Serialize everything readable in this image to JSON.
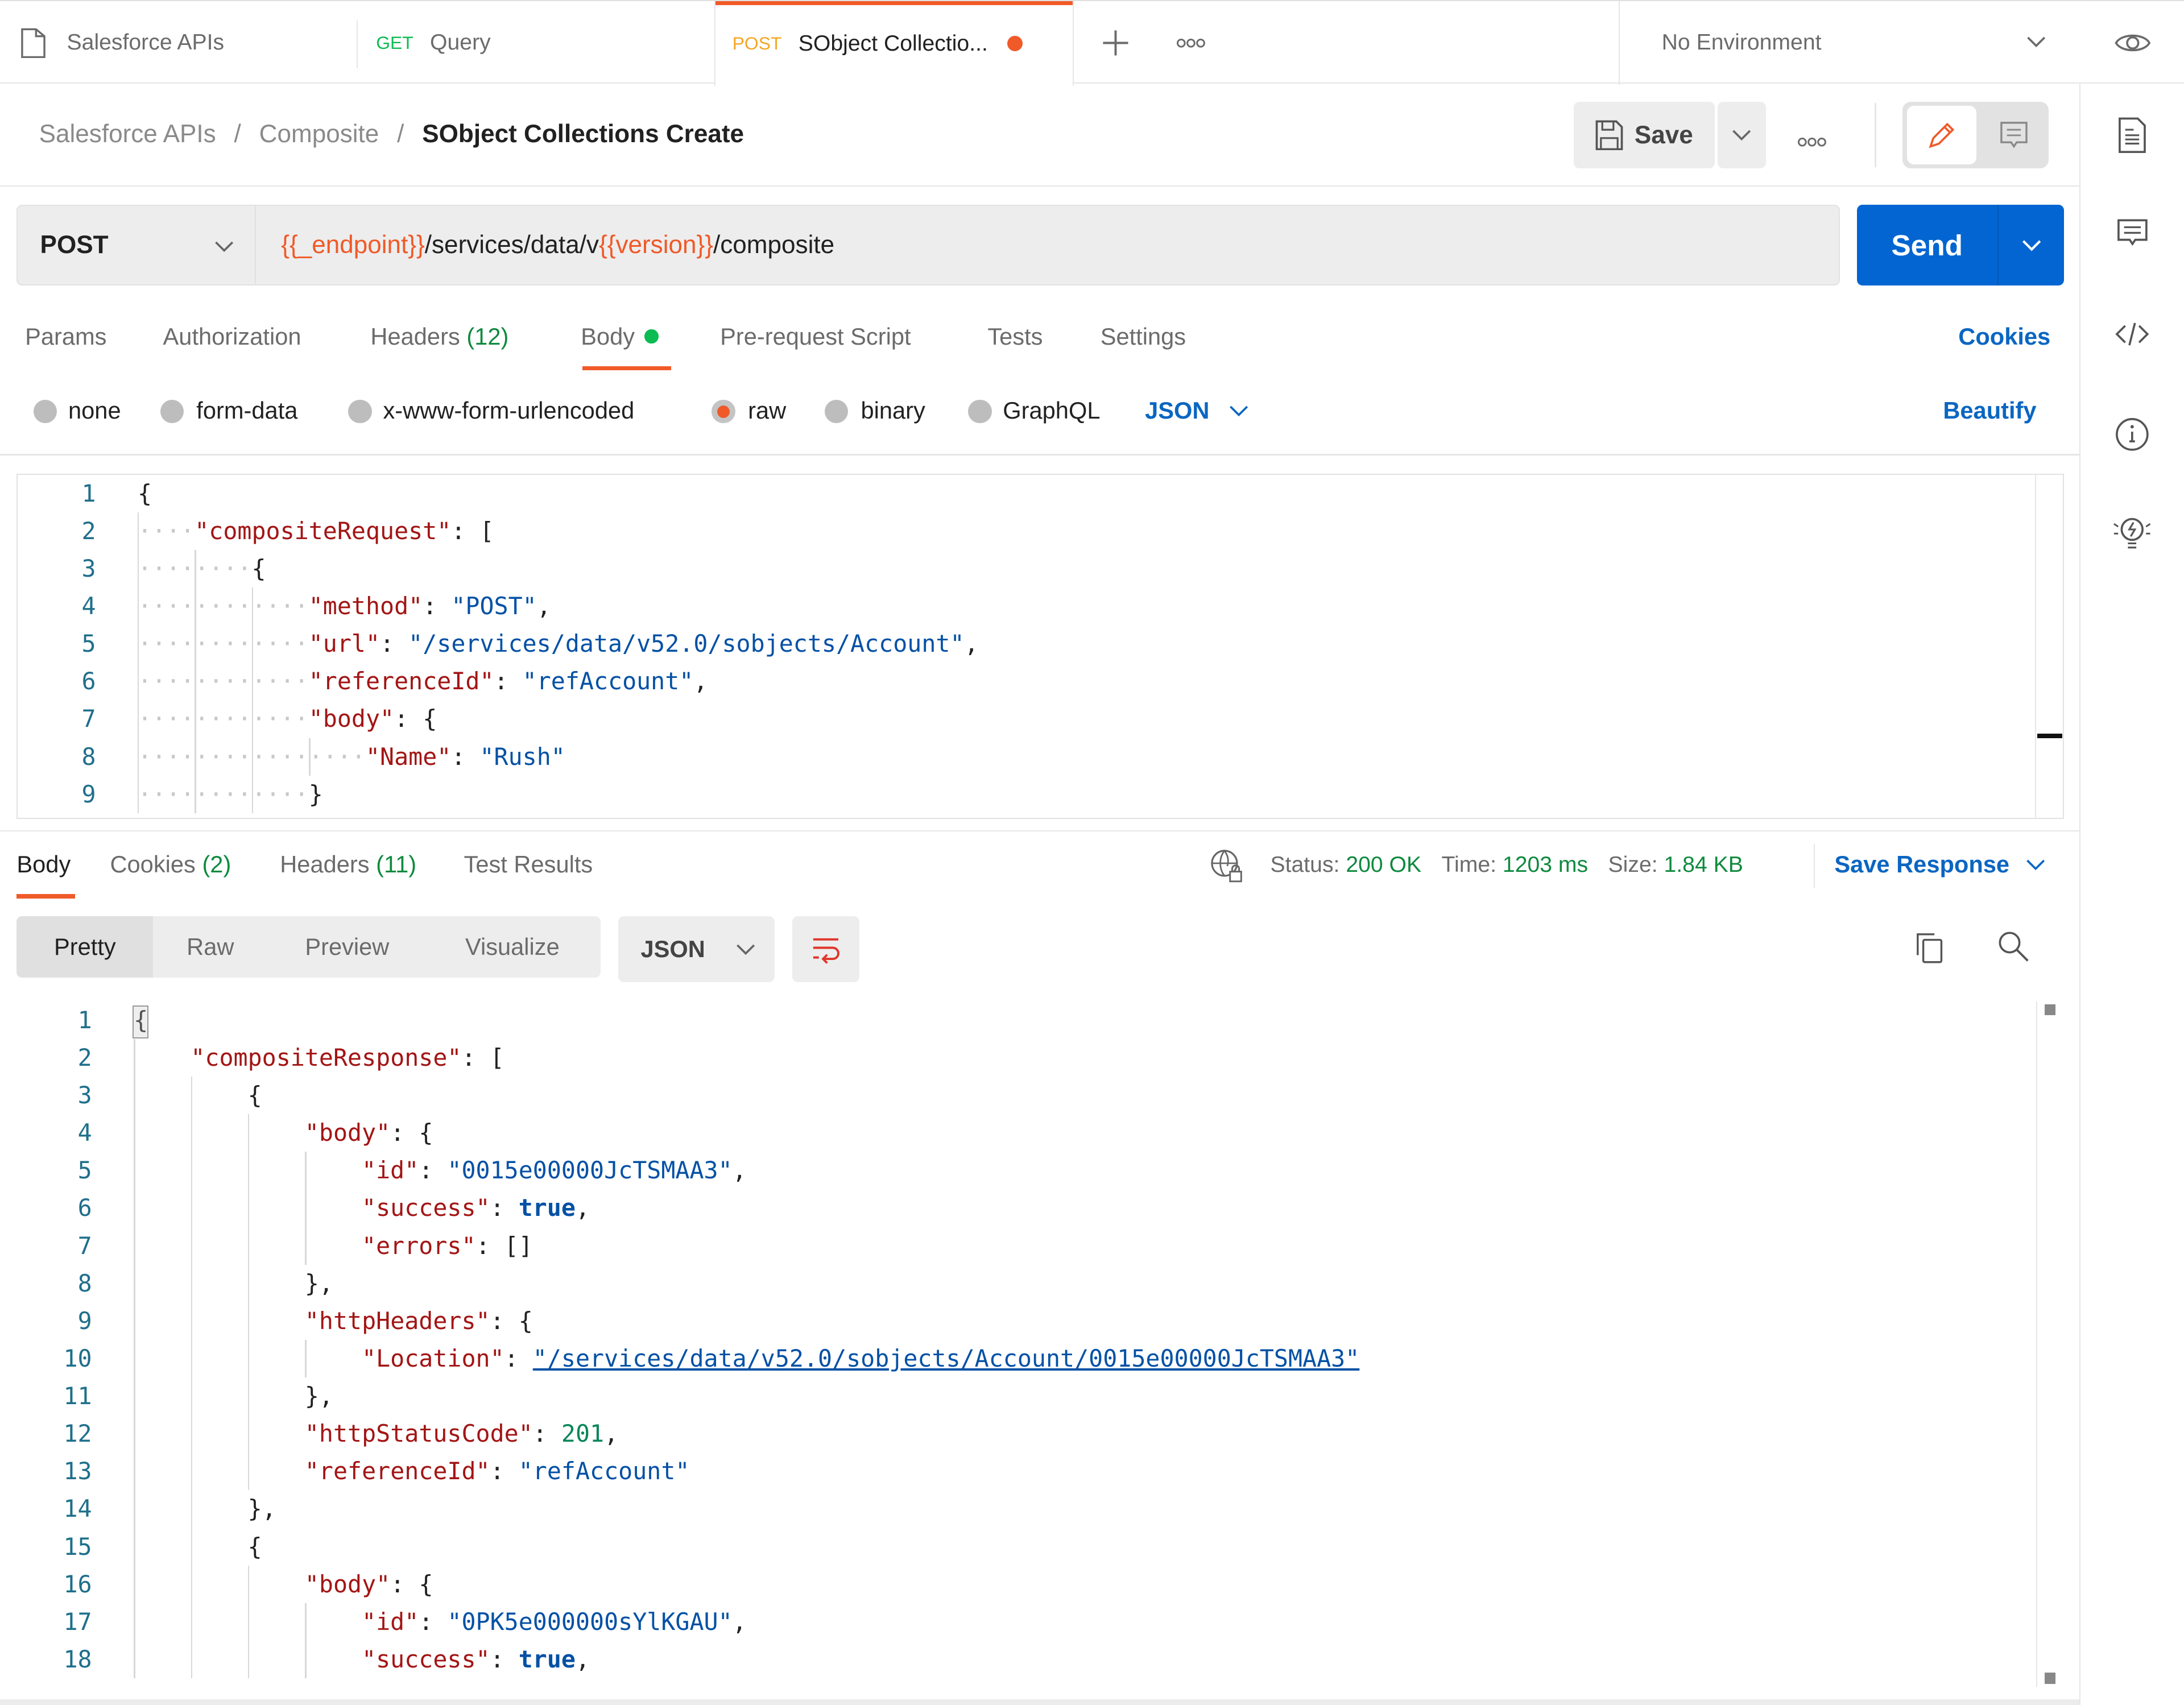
{
  "tabs": [
    {
      "icon": "collection-icon",
      "label": "Salesforce APIs"
    },
    {
      "method": "GET",
      "method_color": "#0cbb52",
      "label": "Query"
    },
    {
      "method": "POST",
      "method_color": "#f5a623",
      "label": "SObject Collectio...",
      "unsaved": true,
      "active": true
    }
  ],
  "tabbar": {
    "environment": "No Environment"
  },
  "breadcrumb": {
    "parts": [
      "Salesforce APIs",
      "Composite"
    ],
    "current": "SObject Collections Create",
    "separator": "/"
  },
  "toolbar": {
    "save_label": "Save"
  },
  "request": {
    "method": "POST",
    "url_parts": [
      {
        "text": "{{_endpoint}}",
        "var": true
      },
      {
        "text": "/services/data/v",
        "var": false
      },
      {
        "text": "{{version}}",
        "var": true
      },
      {
        "text": "/composite",
        "var": false
      }
    ],
    "send_label": "Send"
  },
  "request_tabs": {
    "params": "Params",
    "authorization": "Authorization",
    "headers": "Headers",
    "headers_count": "(12)",
    "body": "Body",
    "prerequest": "Pre-request Script",
    "tests": "Tests",
    "settings": "Settings",
    "cookies": "Cookies"
  },
  "body_modes": {
    "none": "none",
    "form_data": "form-data",
    "urlencoded": "x-www-form-urlencoded",
    "raw": "raw",
    "binary": "binary",
    "graphql": "GraphQL",
    "selected": "raw",
    "format": "JSON",
    "beautify": "Beautify"
  },
  "request_body": [
    {
      "n": "1",
      "indent": 0,
      "tokens": [
        [
          "p",
          "{"
        ]
      ]
    },
    {
      "n": "2",
      "indent": 1,
      "tokens": [
        [
          "k",
          "\"compositeRequest\""
        ],
        [
          "p",
          ": ["
        ]
      ]
    },
    {
      "n": "3",
      "indent": 2,
      "tokens": [
        [
          "p",
          "{"
        ]
      ]
    },
    {
      "n": "4",
      "indent": 3,
      "tokens": [
        [
          "k",
          "\"method\""
        ],
        [
          "p",
          ": "
        ],
        [
          "s",
          "\"POST\""
        ],
        [
          "p",
          ","
        ]
      ]
    },
    {
      "n": "5",
      "indent": 3,
      "tokens": [
        [
          "k",
          "\"url\""
        ],
        [
          "p",
          ": "
        ],
        [
          "s",
          "\"/services/data/v52.0/sobjects/Account\""
        ],
        [
          "p",
          ","
        ]
      ]
    },
    {
      "n": "6",
      "indent": 3,
      "tokens": [
        [
          "k",
          "\"referenceId\""
        ],
        [
          "p",
          ": "
        ],
        [
          "s",
          "\"refAccount\""
        ],
        [
          "p",
          ","
        ]
      ]
    },
    {
      "n": "7",
      "indent": 3,
      "tokens": [
        [
          "k",
          "\"body\""
        ],
        [
          "p",
          ": {"
        ]
      ]
    },
    {
      "n": "8",
      "indent": 4,
      "tokens": [
        [
          "k",
          "\"Name\""
        ],
        [
          "p",
          ": "
        ],
        [
          "s",
          "\"Rush\""
        ]
      ]
    },
    {
      "n": "9",
      "indent": 3,
      "tokens": [
        [
          "p",
          "}"
        ]
      ]
    }
  ],
  "response_tabs": {
    "body": "Body",
    "cookies": "Cookies",
    "cookies_count": "(2)",
    "headers": "Headers",
    "headers_count": "(11)",
    "test_results": "Test Results"
  },
  "response_meta": {
    "status_label": "Status:",
    "status": "200 OK",
    "time_label": "Time:",
    "time": "1203 ms",
    "size_label": "Size:",
    "size": "1.84 KB",
    "save_response": "Save Response"
  },
  "response_view": {
    "pretty": "Pretty",
    "raw": "Raw",
    "preview": "Preview",
    "visualize": "Visualize",
    "format": "JSON"
  },
  "response_body": [
    {
      "n": "1",
      "indent": 0,
      "tokens": [
        [
          "p",
          "{"
        ]
      ]
    },
    {
      "n": "2",
      "indent": 1,
      "tokens": [
        [
          "k",
          "\"compositeResponse\""
        ],
        [
          "p",
          ": ["
        ]
      ]
    },
    {
      "n": "3",
      "indent": 2,
      "tokens": [
        [
          "p",
          "{"
        ]
      ]
    },
    {
      "n": "4",
      "indent": 3,
      "tokens": [
        [
          "k",
          "\"body\""
        ],
        [
          "p",
          ": {"
        ]
      ]
    },
    {
      "n": "5",
      "indent": 4,
      "tokens": [
        [
          "k",
          "\"id\""
        ],
        [
          "p",
          ": "
        ],
        [
          "s",
          "\"0015e00000JcTSMAA3\""
        ],
        [
          "p",
          ","
        ]
      ]
    },
    {
      "n": "6",
      "indent": 4,
      "tokens": [
        [
          "k",
          "\"success\""
        ],
        [
          "p",
          ": "
        ],
        [
          "b",
          "true"
        ],
        [
          "p",
          ","
        ]
      ]
    },
    {
      "n": "7",
      "indent": 4,
      "tokens": [
        [
          "k",
          "\"errors\""
        ],
        [
          "p",
          ": []"
        ]
      ]
    },
    {
      "n": "8",
      "indent": 3,
      "tokens": [
        [
          "p",
          "},"
        ]
      ]
    },
    {
      "n": "9",
      "indent": 3,
      "tokens": [
        [
          "k",
          "\"httpHeaders\""
        ],
        [
          "p",
          ": {"
        ]
      ]
    },
    {
      "n": "10",
      "indent": 4,
      "tokens": [
        [
          "k",
          "\"Location\""
        ],
        [
          "p",
          ": "
        ],
        [
          "u",
          "\"/services/data/v52.0/sobjects/Account/0015e00000JcTSMAA3\""
        ]
      ]
    },
    {
      "n": "11",
      "indent": 3,
      "tokens": [
        [
          "p",
          "},"
        ]
      ]
    },
    {
      "n": "12",
      "indent": 3,
      "tokens": [
        [
          "k",
          "\"httpStatusCode\""
        ],
        [
          "p",
          ": "
        ],
        [
          "n",
          "201"
        ],
        [
          "p",
          ","
        ]
      ]
    },
    {
      "n": "13",
      "indent": 3,
      "tokens": [
        [
          "k",
          "\"referenceId\""
        ],
        [
          "p",
          ": "
        ],
        [
          "s",
          "\"refAccount\""
        ]
      ]
    },
    {
      "n": "14",
      "indent": 2,
      "tokens": [
        [
          "p",
          "},"
        ]
      ]
    },
    {
      "n": "15",
      "indent": 2,
      "tokens": [
        [
          "p",
          "{"
        ]
      ]
    },
    {
      "n": "16",
      "indent": 3,
      "tokens": [
        [
          "k",
          "\"body\""
        ],
        [
          "p",
          ": {"
        ]
      ]
    },
    {
      "n": "17",
      "indent": 4,
      "tokens": [
        [
          "k",
          "\"id\""
        ],
        [
          "p",
          ": "
        ],
        [
          "s",
          "\"0PK5e000000sYlKGAU\""
        ],
        [
          "p",
          ","
        ]
      ]
    },
    {
      "n": "18",
      "indent": 4,
      "tokens": [
        [
          "k",
          "\"success\""
        ],
        [
          "p",
          ": "
        ],
        [
          "b",
          "true"
        ],
        [
          "p",
          ","
        ]
      ]
    }
  ],
  "colors": {
    "accent": "#f05a28",
    "primary": "#0265d2",
    "link": "#0a66c2",
    "success": "#0e8a3e"
  }
}
